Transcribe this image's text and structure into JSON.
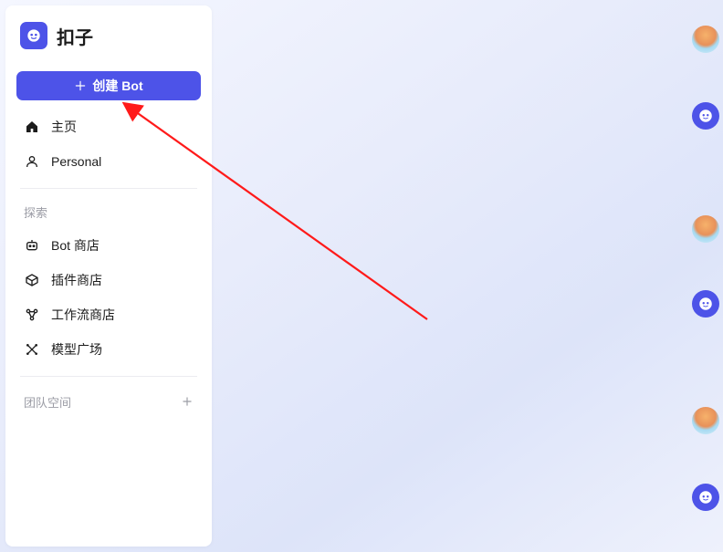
{
  "brand": {
    "name": "扣子"
  },
  "createButton": {
    "label": "创建 Bot"
  },
  "nav": {
    "home": "主页",
    "personal": "Personal"
  },
  "explore": {
    "label": "探索",
    "botStore": "Bot 商店",
    "pluginStore": "插件商店",
    "workflowStore": "工作流商店",
    "modelPlaza": "模型广场"
  },
  "teamSpace": {
    "label": "团队空间"
  }
}
